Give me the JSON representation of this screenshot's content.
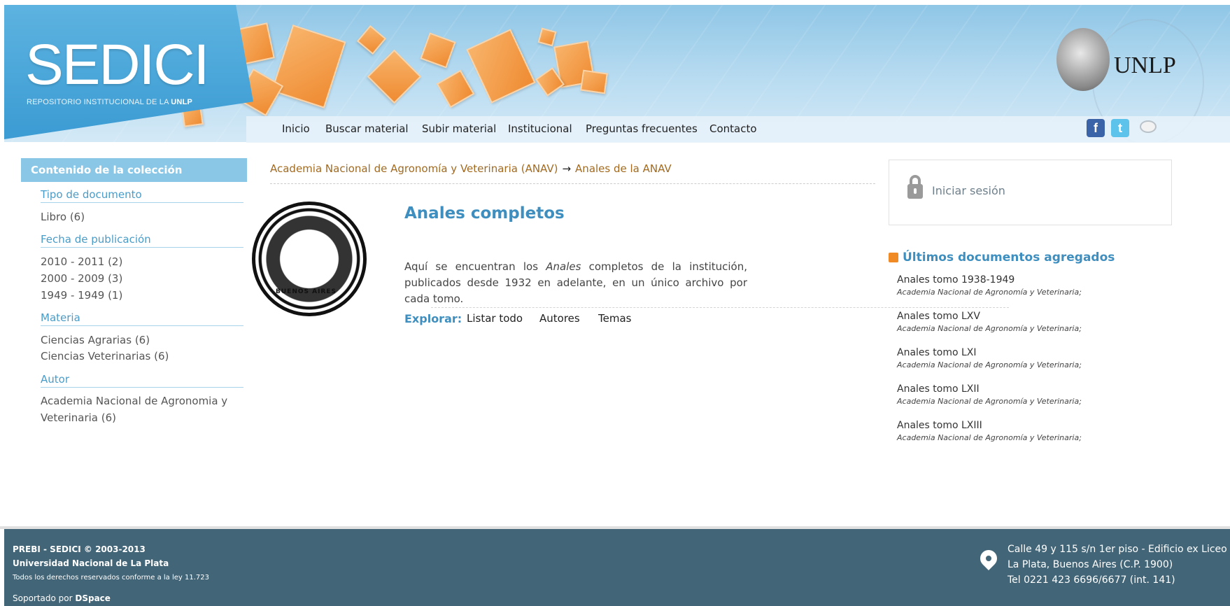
{
  "header": {
    "logo": "SEDICI",
    "logo_sub_prefix": "REPOSITORIO INSTITUCIONAL DE LA ",
    "logo_sub_bold": "UNLP",
    "unlp": "UNLP",
    "nav": [
      "Inicio",
      "Buscar material",
      "Subir material",
      "Institucional",
      "Preguntas frecuentes",
      "Contacto"
    ],
    "social_icons": [
      "facebook-icon",
      "twitter-icon",
      "chat-bubble-icon"
    ]
  },
  "sidebar": {
    "heading": "Contenido de la colección",
    "facets": [
      {
        "title": "Tipo de documento",
        "items": [
          "Libro (6)"
        ]
      },
      {
        "title": "Fecha de publicación",
        "items": [
          "2010 - 2011 (2)",
          "2000 - 2009 (3)",
          "1949 - 1949 (1)"
        ]
      },
      {
        "title": "Materia",
        "items": [
          "Ciencias Agrarias (6)",
          "Ciencias Veterinarias (6)"
        ]
      },
      {
        "title": "Autor",
        "items": [
          "Academia Nacional de Agronomia y",
          "Veterinaria (6)"
        ]
      }
    ]
  },
  "main": {
    "breadcrumb": [
      "Academia Nacional de Agronomía y Veterinaria (ANAV)",
      "→",
      "Anales de la ANAV"
    ],
    "emblem_text": "BUENOS AIRES",
    "title": "Anales completos",
    "desc_1": "Aquí se encuentran los ",
    "desc_em": "Anales",
    "desc_2": " completos de la institución, publicados desde 1932 en adelante, en un único archivo por cada tomo.",
    "explore_label": "Explorar:",
    "explore_links": [
      "Listar todo",
      "Autores",
      "Temas"
    ]
  },
  "right": {
    "login": "Iniciar sesión",
    "recent_title": "Últimos documentos agregados",
    "recent": [
      {
        "title": "Anales tomo 1938-1949",
        "author": "Academia Nacional de Agronomía y Veterinaria;"
      },
      {
        "title": "Anales tomo LXV",
        "author": "Academia Nacional de Agronomía y Veterinaria;"
      },
      {
        "title": "Anales tomo LXI",
        "author": "Academia Nacional de Agronomía y Veterinaria;"
      },
      {
        "title": "Anales tomo LXII",
        "author": "Academia Nacional de Agronomía y Veterinaria;"
      },
      {
        "title": "Anales tomo LXIII",
        "author": "Academia Nacional de Agronomía y Veterinaria;"
      }
    ]
  },
  "footer": {
    "line1": "PREBI - SEDICI © 2003-2013",
    "line2": "Universidad Nacional de La Plata",
    "line3": "Todos los derechos reservados conforme a la ley 11.723",
    "powered_prefix": "Soportado por ",
    "powered_bold": "DSpace",
    "address": [
      "Calle 49 y 115 s/n 1er piso - Edificio ex Liceo",
      "La Plata, Buenos Aires (C.P. 1900)",
      "Tel 0221 423 6696/6677 (int. 141)"
    ]
  },
  "colors": {
    "accent": "#3e8fbf",
    "breadcrumb": "#a26a20",
    "footer": "#426577",
    "sidebar_head": "#8ac7e6"
  }
}
